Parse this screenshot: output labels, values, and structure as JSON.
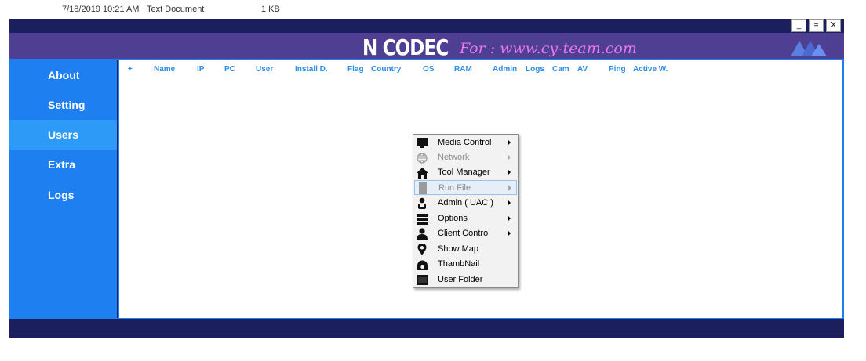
{
  "background_file": {
    "date": "7/18/2019 10:21 AM",
    "type": "Text Document",
    "size": "1 KB"
  },
  "window": {
    "title": "N CODEC",
    "subtitle": "For : www.cy-team.com",
    "minimize_label": "_",
    "maximize_label": "=",
    "close_label": "X",
    "colors": {
      "header": "#4e3f92",
      "sidebar": "#1e7ff0",
      "active": "#2e9af8",
      "frame": "#1f2266",
      "subtitle": "#e978e9"
    }
  },
  "sidebar": {
    "items": [
      {
        "label": "About",
        "active": false
      },
      {
        "label": "Setting",
        "active": false
      },
      {
        "label": "Users",
        "active": true
      },
      {
        "label": "Extra",
        "active": false
      },
      {
        "label": "Logs",
        "active": false
      }
    ]
  },
  "table": {
    "columns": [
      "+",
      "Name",
      "IP",
      "PC",
      "User",
      "Install D.",
      "Flag",
      "Country",
      "OS",
      "RAM",
      "Admin",
      "Logs",
      "Cam",
      "AV",
      "Ping",
      "Active W."
    ],
    "rows": []
  },
  "context_menu": {
    "items": [
      {
        "label": "Media Control",
        "icon": "monitor-icon",
        "submenu": true,
        "enabled": true
      },
      {
        "label": "Network",
        "icon": "globe-icon",
        "submenu": true,
        "enabled": false
      },
      {
        "label": "Tool Manager",
        "icon": "home-icon",
        "submenu": true,
        "enabled": true
      },
      {
        "label": "Run File",
        "icon": "file-icon",
        "submenu": true,
        "enabled": false,
        "highlighted": true
      },
      {
        "label": "Admin ( UAC )",
        "icon": "admin-icon",
        "submenu": true,
        "enabled": true
      },
      {
        "label": "Options",
        "icon": "grid-icon",
        "submenu": true,
        "enabled": true
      },
      {
        "label": "Client Control",
        "icon": "user-icon",
        "submenu": true,
        "enabled": true
      },
      {
        "label": "Show Map",
        "icon": "map-pin-icon",
        "submenu": false,
        "enabled": true
      },
      {
        "label": "ThambNail",
        "icon": "thumbnail-icon",
        "submenu": false,
        "enabled": true
      },
      {
        "label": "User Folder",
        "icon": "folder-icon",
        "submenu": false,
        "enabled": true
      }
    ]
  }
}
